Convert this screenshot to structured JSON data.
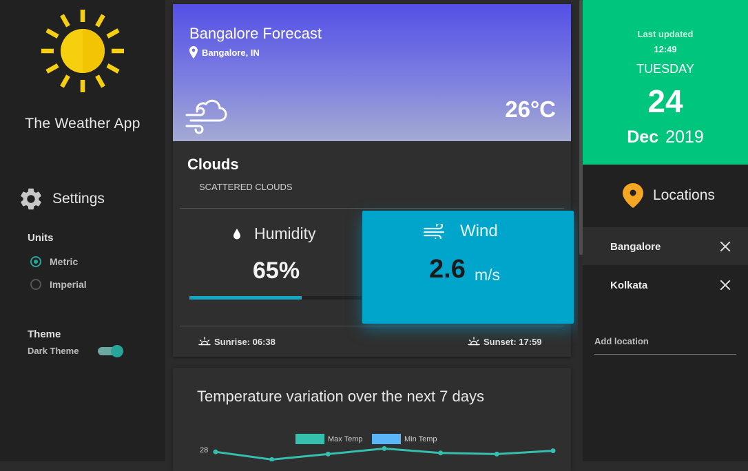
{
  "app": {
    "title": "The Weather App",
    "logo_icon": "sun-icon"
  },
  "settings": {
    "title": "Settings",
    "units_label": "Units",
    "units_options": [
      "Metric",
      "Imperial"
    ],
    "units_selected": "Metric",
    "theme_label": "Theme",
    "dark_theme_label": "Dark Theme",
    "dark_theme_on": true
  },
  "forecast": {
    "title": "Bangalore Forecast",
    "location": "Bangalore, IN",
    "temperature": "26°C",
    "condition": "Clouds",
    "description": "SCATTERED CLOUDS",
    "humidity_label": "Humidity",
    "humidity_value": "65%",
    "humidity_fraction": 0.65,
    "wind_label": "Wind",
    "wind_value": "2.6",
    "wind_unit": "m/s",
    "sunrise": "Sunrise: 06:38",
    "sunset": "Sunset: 17:59"
  },
  "chart": {
    "title": "Temperature variation over the next 7 days"
  },
  "chart_data": {
    "type": "line",
    "title": "Temperature variation over the next 7 days",
    "y_tick_visible": "28",
    "series": [
      {
        "name": "Max Temp",
        "color": "#35bfae",
        "values": [
          27.8,
          27.1,
          27.6,
          28.1,
          27.7,
          27.6,
          27.9
        ]
      },
      {
        "name": "Min Temp",
        "color": "#5ab6f6",
        "values": []
      }
    ],
    "legend_position": "top"
  },
  "date_panel": {
    "last_updated_label": "Last updated",
    "time": "12:49",
    "weekday": "TUESDAY",
    "day": "24",
    "month": "Dec",
    "year": "2019",
    "color": "#00c67d"
  },
  "locations": {
    "title": "Locations",
    "items": [
      {
        "name": "Bangalore",
        "active": true
      },
      {
        "name": "Kolkata",
        "active": false
      }
    ],
    "add_placeholder": "Add location"
  }
}
